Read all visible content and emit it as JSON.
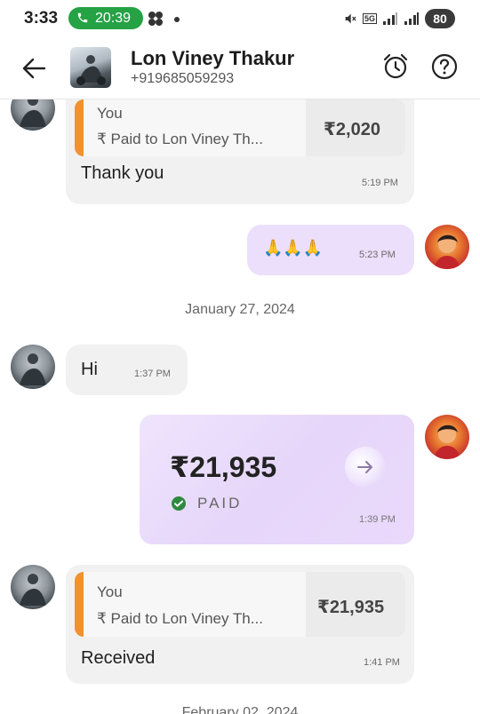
{
  "status_bar": {
    "time": "3:33",
    "call_duration": "20:39",
    "network": "5G",
    "battery": "80"
  },
  "header": {
    "contact_name": "Lon Viney Thakur",
    "contact_phone": "+919685059293"
  },
  "messages": [
    {
      "direction": "incoming",
      "reply_author": "You",
      "reply_text": "₹ Paid to Lon Viney Th...",
      "reply_amount": "₹2,020",
      "text": "Thank you",
      "time": "5:19 PM"
    },
    {
      "direction": "outgoing",
      "text": "🙏🙏🙏",
      "time": "5:23 PM"
    },
    {
      "date_separator": "January 27, 2024"
    },
    {
      "direction": "incoming",
      "text": "Hi",
      "time": "1:37 PM"
    },
    {
      "direction": "outgoing",
      "type": "payment",
      "amount": "₹21,935",
      "status": "PAID",
      "time": "1:39 PM"
    },
    {
      "direction": "incoming",
      "reply_author": "You",
      "reply_text": "₹ Paid to Lon Viney Th...",
      "reply_amount": "₹21,935",
      "text": "Received",
      "time": "1:41 PM"
    },
    {
      "date_separator": "February 02, 2024"
    }
  ],
  "colors": {
    "accent_green": "#25a244",
    "reply_bar": "#f0932b",
    "outgoing_bubble": "#ecdffb",
    "incoming_bubble": "#f1f1f1"
  }
}
